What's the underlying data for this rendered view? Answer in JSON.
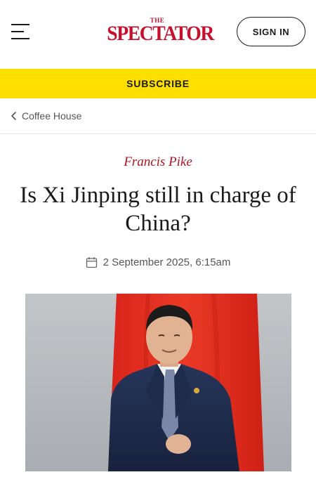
{
  "header": {
    "logo_small": "THE",
    "logo_main": "SPECTATOR",
    "signin_label": "SIGN IN",
    "menu_icon": "hamburger-menu-icon"
  },
  "subscribe": {
    "label": "SUBSCRIBE"
  },
  "breadcrumb": {
    "label": "Coffee House",
    "icon": "chevron-left-icon"
  },
  "article": {
    "author": "Francis Pike",
    "headline": "Is Xi Jinping still in charge of China?",
    "date": "2 September 2025, 6:15am",
    "date_icon": "calendar-icon"
  },
  "colors": {
    "brand_red": "#c8102e",
    "author_red": "#b0141f",
    "subscribe_yellow": "#ffdf00",
    "flag_red": "#e0261d"
  }
}
